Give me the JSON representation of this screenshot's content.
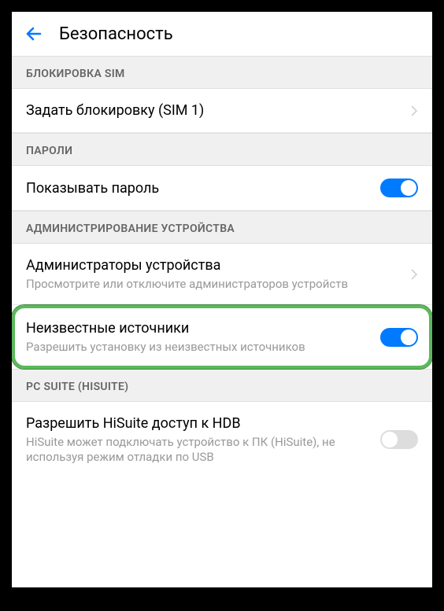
{
  "header": {
    "title": "Безопасность"
  },
  "sections": {
    "sim_lock": {
      "header": "БЛОКИРОВКА SIM",
      "set_lock": {
        "title": "Задать блокировку (SIM 1)"
      }
    },
    "passwords": {
      "header": "ПАРОЛИ",
      "show_password": {
        "title": "Показывать пароль",
        "enabled": true
      }
    },
    "device_admin": {
      "header": "АДМИНИСТРИРОВАНИЕ УСТРОЙСТВА",
      "admins": {
        "title": "Администраторы устройства",
        "subtitle": "Просмотрите или отключите администраторов устройств"
      },
      "unknown_sources": {
        "title": "Неизвестные источники",
        "subtitle": "Разрешить установку из неизвестных источников",
        "enabled": true
      }
    },
    "pc_suite": {
      "header": "PC SUITE (HISUITE)",
      "hdb": {
        "title": "Разрешить HiSuite доступ к HDB",
        "subtitle": "HiSuite может подключать устройство к ПК (HiSuite), не используя режим отладки по USB",
        "enabled": false
      }
    }
  }
}
